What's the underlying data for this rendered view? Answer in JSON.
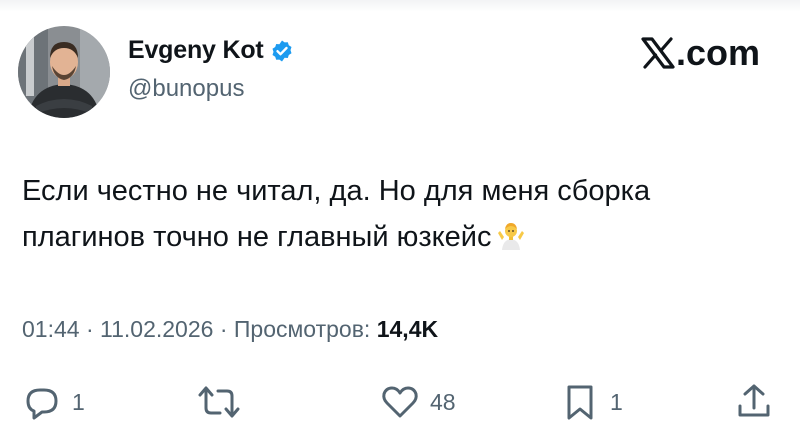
{
  "author": {
    "name": "Evgeny Kot",
    "handle": "@bunopus",
    "verified": true
  },
  "brand": {
    "text": ".com",
    "logo_icon": "x-logo-icon"
  },
  "tweet": {
    "lines": [
      "Если честно не читал, да. Но для меня сборка",
      "плагинов точно не главный юзкейс"
    ],
    "emoji": "person-shrugging-emoji"
  },
  "meta": {
    "time": "01:44",
    "separator": "·",
    "date": "11.02.2026",
    "views_label": "Просмотров:",
    "views_count": "14,4K"
  },
  "actions": {
    "replies": {
      "icon": "reply-icon",
      "count": "1"
    },
    "retweets": {
      "icon": "retweet-icon",
      "count": ""
    },
    "likes": {
      "icon": "heart-icon",
      "count": "48"
    },
    "bookmarks": {
      "icon": "bookmark-icon",
      "count": "1"
    },
    "share": {
      "icon": "share-icon",
      "count": ""
    }
  },
  "colors": {
    "text": "#0f1419",
    "secondary": "#536471",
    "verified": "#1d9bf0",
    "background": "#ffffff"
  }
}
